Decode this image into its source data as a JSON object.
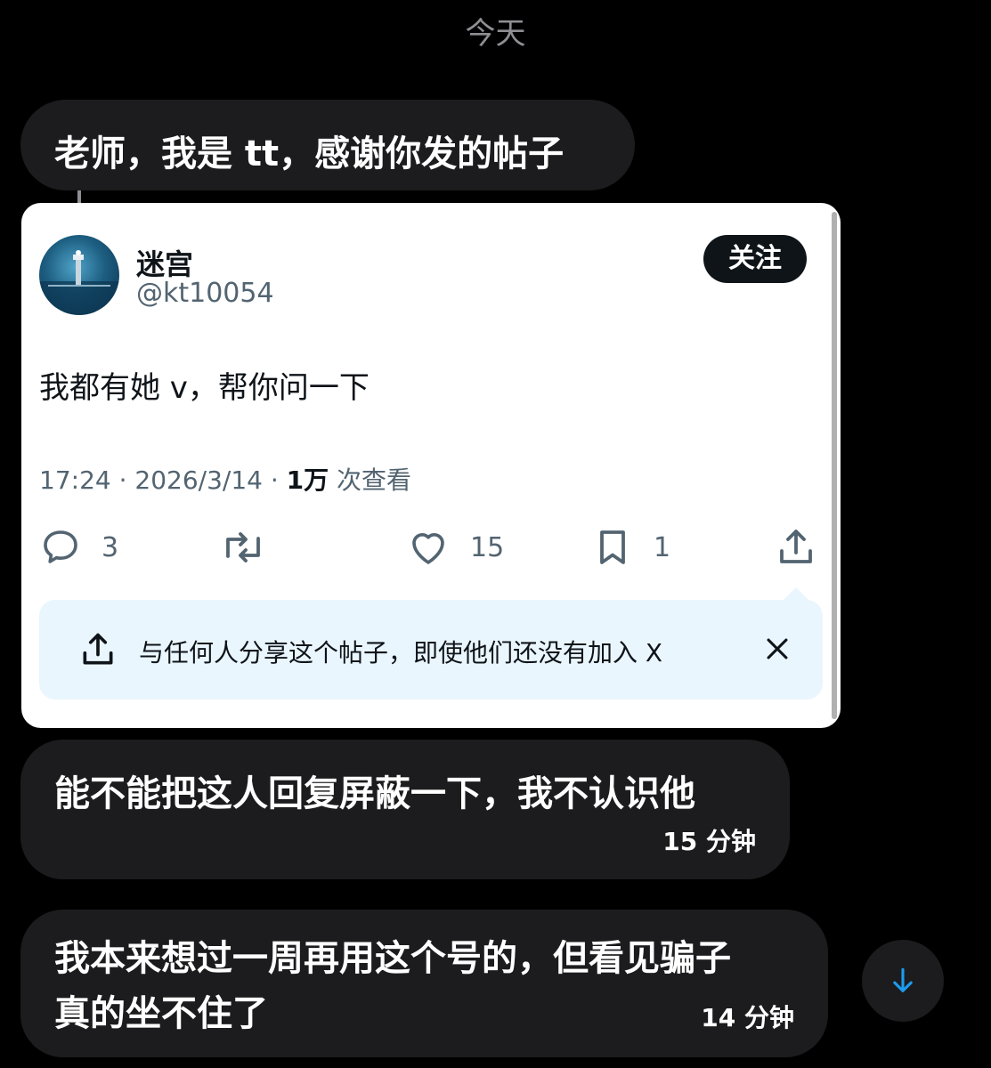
{
  "date_separator": "今天",
  "messages": [
    {
      "text": "老师，我是 tt，感谢你发的帖子"
    },
    {
      "text": "能不能把这人回复屏蔽一下，我不认识他",
      "time": "15 分钟"
    },
    {
      "lines": [
        "我本来想过一周再用这个号的，但看见骗子",
        "真的坐不住了"
      ],
      "time": "14 分钟"
    }
  ],
  "post": {
    "display_name": "迷宫",
    "handle": "@kt10054",
    "follow_label": "关注",
    "text": "我都有她 v，帮你问一下",
    "meta_time": "17:24 · 2026/3/14 · ",
    "meta_views": "1万",
    "meta_views_suffix": " 次查看",
    "replies": "3",
    "likes": "15",
    "bookmarks": "1",
    "share_tip": "与任何人分享这个帖子，即使他们还没有加入 X"
  },
  "colors": {
    "background": "#000000",
    "bubble": "#1c1c1e",
    "card": "#ffffff",
    "tip_background": "#eaf6fd",
    "muted_text": "#536471",
    "accent_blue": "#1d9bf0"
  },
  "icons": {
    "reply": "comment-icon",
    "repost": "repost-icon",
    "like": "heart-icon",
    "bookmark": "bookmark-icon",
    "share": "share-icon",
    "close": "close-icon",
    "scroll": "arrow-down-icon"
  }
}
